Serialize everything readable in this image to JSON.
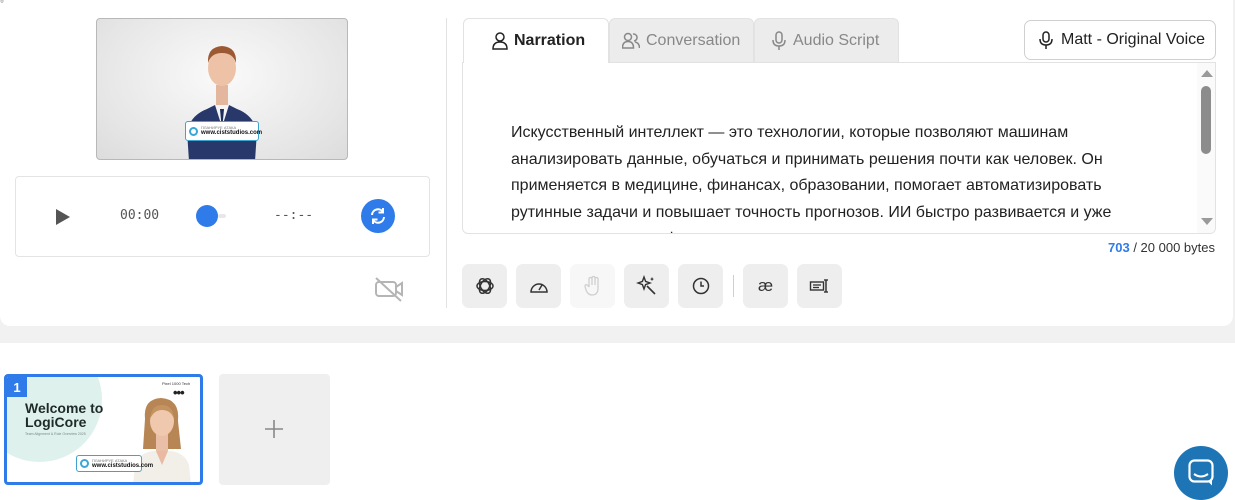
{
  "corner_mark": "°",
  "preview": {
    "tag_small": "ПЛАНИРУЕ АТАКА",
    "tag_url": "www.ciststudios.com"
  },
  "player": {
    "current_time": "00:00",
    "end_time": "--:--",
    "accent": "#2f7bea"
  },
  "tabs": [
    {
      "label": "Narration",
      "icon": "person-icon",
      "active": true
    },
    {
      "label": "Conversation",
      "icon": "people-icon",
      "active": false
    },
    {
      "label": "Audio Script",
      "icon": "microphone-icon",
      "active": false
    }
  ],
  "voice": {
    "label": "Matt - Original Voice",
    "icon": "microphone-icon"
  },
  "editor": {
    "text": "Искусственный интеллект — это технологии, которые позволяют машинам анализировать данные, обучаться и принимать решения почти как человек. Он применяется в медицине, финансах, образовании, помогает автоматизировать рутинные задачи и повышает точность прогнозов. ИИ быстро развивается и уже меняет привычные сферы жизни, открывая"
  },
  "counter": {
    "used": "703",
    "limit": "/ 20 000 bytes"
  },
  "toolbar": [
    {
      "icon": "openai-icon",
      "enabled": true
    },
    {
      "icon": "speedometer-icon",
      "enabled": true
    },
    {
      "icon": "hand-gesture-icon",
      "enabled": false
    },
    {
      "icon": "magic-wand-icon",
      "enabled": true
    },
    {
      "icon": "clock-icon",
      "enabled": true
    },
    {
      "icon": "ae-ligature-icon",
      "label": "æ",
      "enabled": true
    },
    {
      "icon": "text-caption-icon",
      "enabled": true
    }
  ],
  "slides": [
    {
      "number": "1",
      "title": "Welcome to LogiCore",
      "subtitle": "Team Alignment & Role Overview 2025",
      "logo_text": "Pixel 1000 Tech",
      "menu": "•••",
      "tag_small": "ПЛАНИРУЕ АТАКА",
      "tag_url": "www.ciststudios.com"
    }
  ],
  "add_slide": {
    "icon": "plus-icon"
  },
  "chat": {
    "icon": "chat-icon",
    "color": "#1d75b5"
  }
}
